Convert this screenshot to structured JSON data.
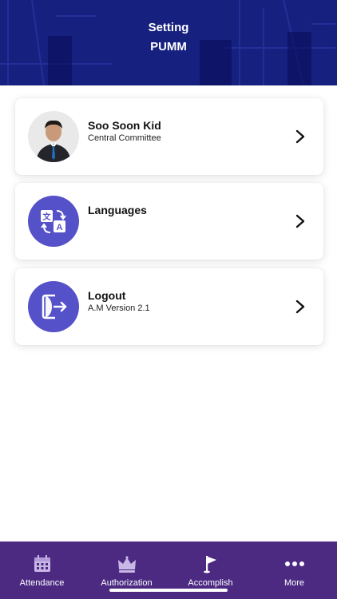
{
  "header": {
    "title_line1": "Setting",
    "title_line2": "PUMM",
    "bg_color": "#151b7e"
  },
  "profile": {
    "name": "Soo Soon Kid",
    "role": "Central Committee"
  },
  "languages": {
    "label": "Languages"
  },
  "logout": {
    "label": "Logout",
    "version": "A.M Version 2.1"
  },
  "tabbar": {
    "bg_color": "#4c2a82",
    "tabs": [
      {
        "label": "Attendance",
        "icon": "calendar-icon"
      },
      {
        "label": "Authorization",
        "icon": "crown-icon"
      },
      {
        "label": "Accomplish",
        "icon": "flag-icon"
      },
      {
        "label": "More",
        "icon": "more-dots-icon"
      }
    ]
  },
  "accent_color": "#5451c9"
}
